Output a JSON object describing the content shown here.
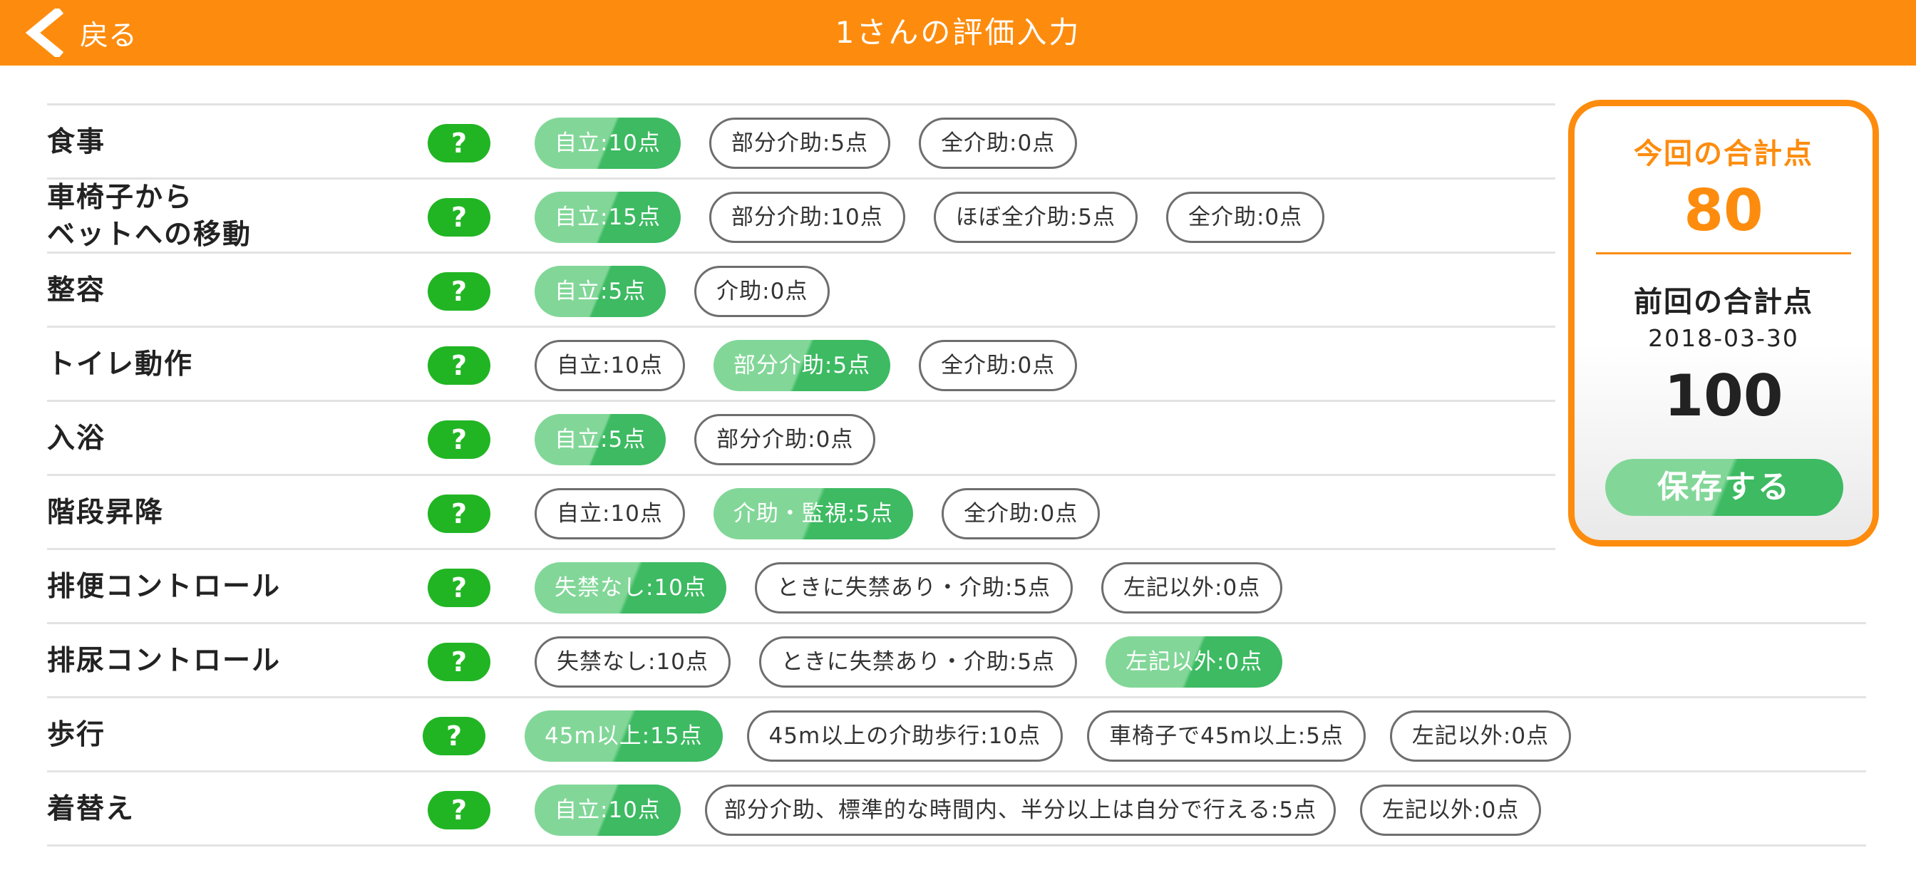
{
  "header": {
    "back_label": "戻る",
    "title": "1さんの評価入力",
    "color": "#fd8c0e"
  },
  "help_label": "?",
  "rows": [
    {
      "label": "食事",
      "options": [
        "自立:10点",
        "部分介助:5点",
        "全介助:0点"
      ],
      "selected": 0
    },
    {
      "label_line1": "車椅子から",
      "label_line2": "ベットへの移動",
      "options": [
        "自立:15点",
        "部分介助:10点",
        "ほぼ全介助:5点",
        "全介助:0点"
      ],
      "selected": 0
    },
    {
      "label": "整容",
      "options": [
        "自立:5点",
        "介助:0点"
      ],
      "selected": 0
    },
    {
      "label": "トイレ動作",
      "options": [
        "自立:10点",
        "部分介助:5点",
        "全介助:0点"
      ],
      "selected": 1
    },
    {
      "label": "入浴",
      "options": [
        "自立:5点",
        "部分介助:0点"
      ],
      "selected": 0
    },
    {
      "label": "階段昇降",
      "options": [
        "自立:10点",
        "介助・監視:5点",
        "全介助:0点"
      ],
      "selected": 1
    },
    {
      "label": "排便コントロール",
      "options": [
        "失禁なし:10点",
        "ときに失禁あり・介助:5点",
        "左記以外:0点"
      ],
      "selected": 0
    },
    {
      "label": "排尿コントロール",
      "options": [
        "失禁なし:10点",
        "ときに失禁あり・介助:5点",
        "左記以外:0点"
      ],
      "selected": 2
    },
    {
      "label": "歩行",
      "options": [
        "45m以上:15点",
        "45m以上の介助歩行:10点",
        "車椅子で45m以上:5点",
        "左記以外:0点"
      ],
      "selected": 0
    },
    {
      "label": "着替え",
      "options": [
        "自立:10点",
        "部分介助、標準的な時間内、半分以上は自分で行える:5点",
        "左記以外:0点"
      ],
      "selected": 0
    }
  ],
  "summary": {
    "current_label": "今回の合計点",
    "current_total": "80",
    "previous_label": "前回の合計点",
    "previous_date": "2018-03-30",
    "previous_total": "100",
    "save_label": "保存する"
  },
  "colors": {
    "accent": "#fd8c0e",
    "help_green": "#21b523",
    "selected_light": "#82d798",
    "selected_dark": "#3dba62"
  }
}
